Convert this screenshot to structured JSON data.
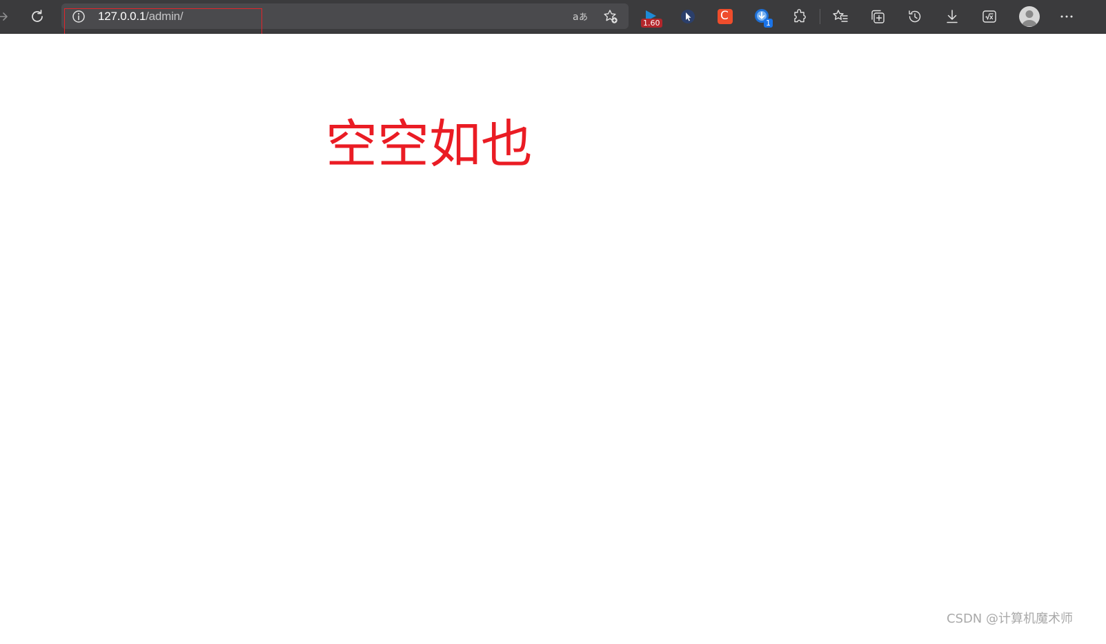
{
  "browser": {
    "address_bar": {
      "url_host": "127.0.0.1",
      "url_path": "/admin/"
    },
    "extensions": {
      "video_speed_badge": "1.60",
      "downloader_badge": "1",
      "csdn_letter": "C"
    },
    "highlight_color": "#e4242a"
  },
  "page": {
    "heading": "空空如也",
    "heading_color": "#ea1c24"
  },
  "watermark": {
    "text": "CSDN @计算机魔术师"
  }
}
